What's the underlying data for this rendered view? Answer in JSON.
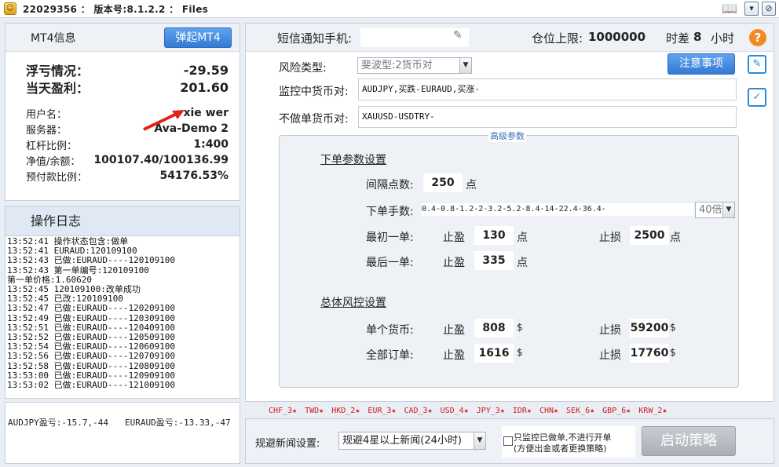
{
  "titlebar": {
    "title": "22029356 ： 版本号:8.1.2.2 ： Files",
    "buttons": {
      "minimize": "▾",
      "close": "⊘"
    }
  },
  "account_panel": {
    "header_title": "MT4信息",
    "popup_button": "弹起MT4",
    "floating_label": "浮亏情况：",
    "floating_value": "-29.59",
    "today_label": "当天盈利：",
    "today_value": "201.60",
    "fields": [
      {
        "label": "用户名：",
        "value": "xie wer"
      },
      {
        "label": "服务器：",
        "value": "Ava-Demo 2"
      },
      {
        "label": "杠杆比例：",
        "value": "1:400"
      },
      {
        "label": "净值/余额：",
        "value": "100107.40/100136.99"
      },
      {
        "label": "预付款比例：",
        "value": "54176.53%"
      }
    ]
  },
  "log_panel": {
    "title": "操作日志",
    "entries": [
      "13:52:41 操作状态包含:做单",
      "13:52:41 EURAUD:120109100",
      "13:52:43 已做:EURAUD----120109100",
      "13:52:43 第一单编号:120109100",
      "第一单价格:1.60620",
      "13:52:45 120109100:改单成功",
      "13:52:45 已改:120109100",
      "13:52:47 已做:EURAUD----120209100",
      "13:52:49 已做:EURAUD----120309100",
      "13:52:51 已做:EURAUD----120409100",
      "13:52:52 已做:EURAUD----120509100",
      "13:52:54 已做:EURAUD----120609100",
      "13:52:56 已做:EURAUD----120709100",
      "13:52:58 已做:EURAUD----120809100",
      "13:53:00 已做:EURAUD----120909100",
      "13:53:02 已做:EURAUD----121009100"
    ]
  },
  "pnl_summary": {
    "audjpy": "AUDJPY盈亏:-15.7,-44",
    "euraud": "EURAUD盈亏:-13.33,-47"
  },
  "settings": {
    "sms_label": "短信通知手机:",
    "sms_value": "",
    "position_limit_label": "仓位上限:",
    "position_limit_value": "1000000",
    "timezone_label": "时差",
    "timezone_value": "8",
    "timezone_unit": "小时",
    "help": "?",
    "risk_type_label": "风险类型:",
    "risk_type_value": "斐波型:2货币对",
    "notice_button": "注意事项",
    "monitor_label": "监控中货币对:",
    "monitor_value": "AUDJPY,买跌-EURAUD,买涨-",
    "exclude_label": "不做单货币对:",
    "exclude_value": "XAUUSD-USDTRY-"
  },
  "advanced": {
    "legend": "高级参数",
    "order_section": "下单参数设置",
    "interval_label": "间隔点数:",
    "interval_value": "250",
    "interval_unit": "点",
    "lots_label": "下单手数:",
    "lots_value": "0.4-0.8-1.2-2-3.2-5.2-8.4-14-22.4-36.4-",
    "lots_multiplier": "40倍",
    "first_label": "最初一单:",
    "last_label": "最后一单:",
    "tp_label": "止盈",
    "sl_label": "止损",
    "first_tp": "130",
    "first_sl": "2500",
    "last_tp": "335",
    "point_unit": "点",
    "risk_section": "总体风控设置",
    "single_label": "单个货币:",
    "all_label": "全部订单:",
    "single_tp": "808",
    "single_sl": "59200",
    "all_tp": "1616",
    "all_sl": "17760",
    "dollar": "$"
  },
  "currencies": [
    "CHF_3★",
    "TWD★",
    "HKD_2★",
    "EUR_3★",
    "CAD_3★",
    "USD_4★",
    "JPY_3★",
    "IDR★",
    "CHN★",
    "SEK_6★",
    "GBP_6★",
    "KRW_2★"
  ],
  "bottom": {
    "news_label": "规避新闻设置:",
    "news_value": "规避4星以上新闻(24小时)",
    "checkbox_line1": "只监控已做单,不进行开单",
    "checkbox_line2": "(方便出金或者更换策略)",
    "start_button": "启动策略"
  },
  "colors": {
    "accent": "#3479d6",
    "currency_red": "#d21a1a",
    "help_orange": "#f08a24",
    "arrow_red": "#e2231a"
  }
}
